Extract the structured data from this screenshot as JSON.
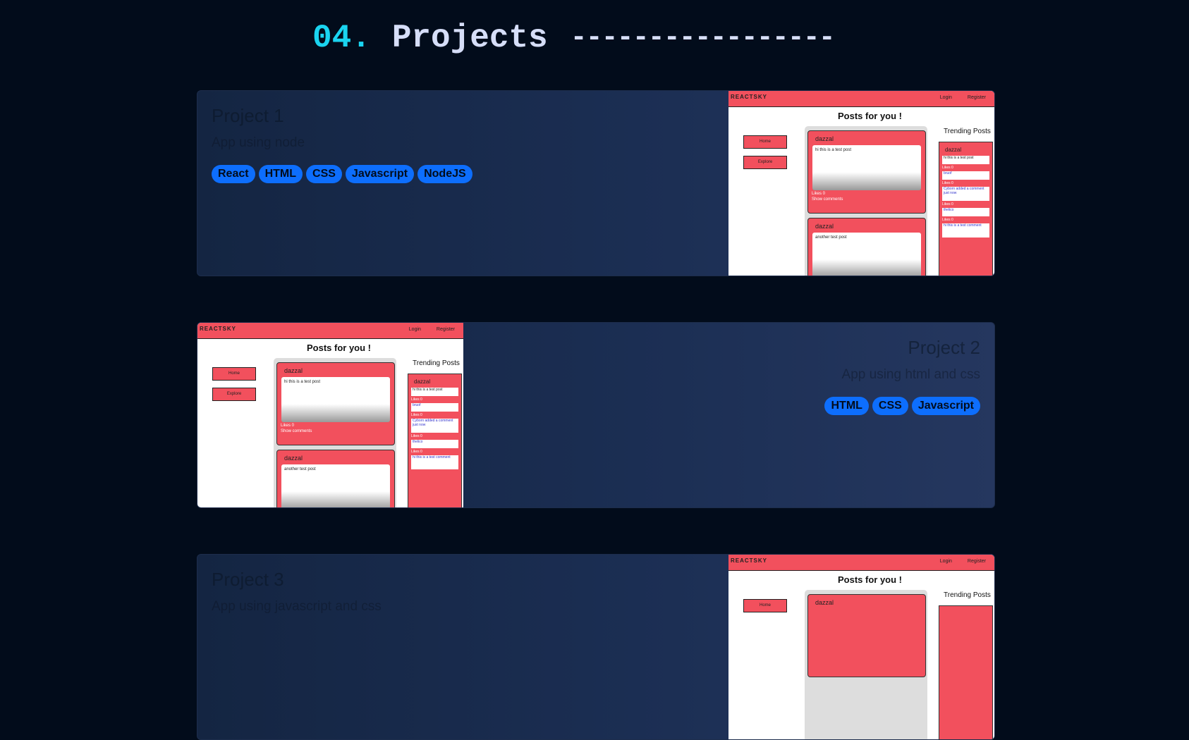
{
  "section": {
    "number": "04.",
    "title": "Projects",
    "dashes": "-----------------"
  },
  "projects": [
    {
      "title": "Project 1",
      "description": "App using node",
      "tags": [
        "React",
        "HTML",
        "CSS",
        "Javascript",
        "NodeJS"
      ]
    },
    {
      "title": "Project 2",
      "description": "App using html and css",
      "tags": [
        "HTML",
        "CSS",
        "Javascript"
      ]
    },
    {
      "title": "Project 3",
      "description": "App using javascript and css",
      "tags": []
    }
  ],
  "screenshot": {
    "logo": "REACTSKY",
    "nav": [
      "Login",
      "Register"
    ],
    "heading": "Posts for you !",
    "buttons": [
      "Home",
      "Explore"
    ],
    "trending_title": "Trending Posts",
    "posts": [
      {
        "user": "dazzal",
        "text": "hi this is a test post",
        "likes": "Likes 0",
        "comments": "Show comments"
      },
      {
        "user": "dazzal",
        "text": "another test post"
      }
    ],
    "trending": [
      {
        "user": "dazzal",
        "text": "hi this is a test post"
      },
      {
        "likes": "Likes 0",
        "text": "bruof"
      },
      {
        "likes": "Likes 0",
        "text": "Cyborn added a comment just now"
      },
      {
        "likes": "Likes 0",
        "text": "thelico"
      },
      {
        "likes": "Likes 0",
        "text": "hi this is a test comment"
      }
    ]
  },
  "colors": {
    "background": "#020c1b",
    "accent": "#1ad4f0",
    "tag": "#0d6efd",
    "card": "#1b2e53"
  }
}
